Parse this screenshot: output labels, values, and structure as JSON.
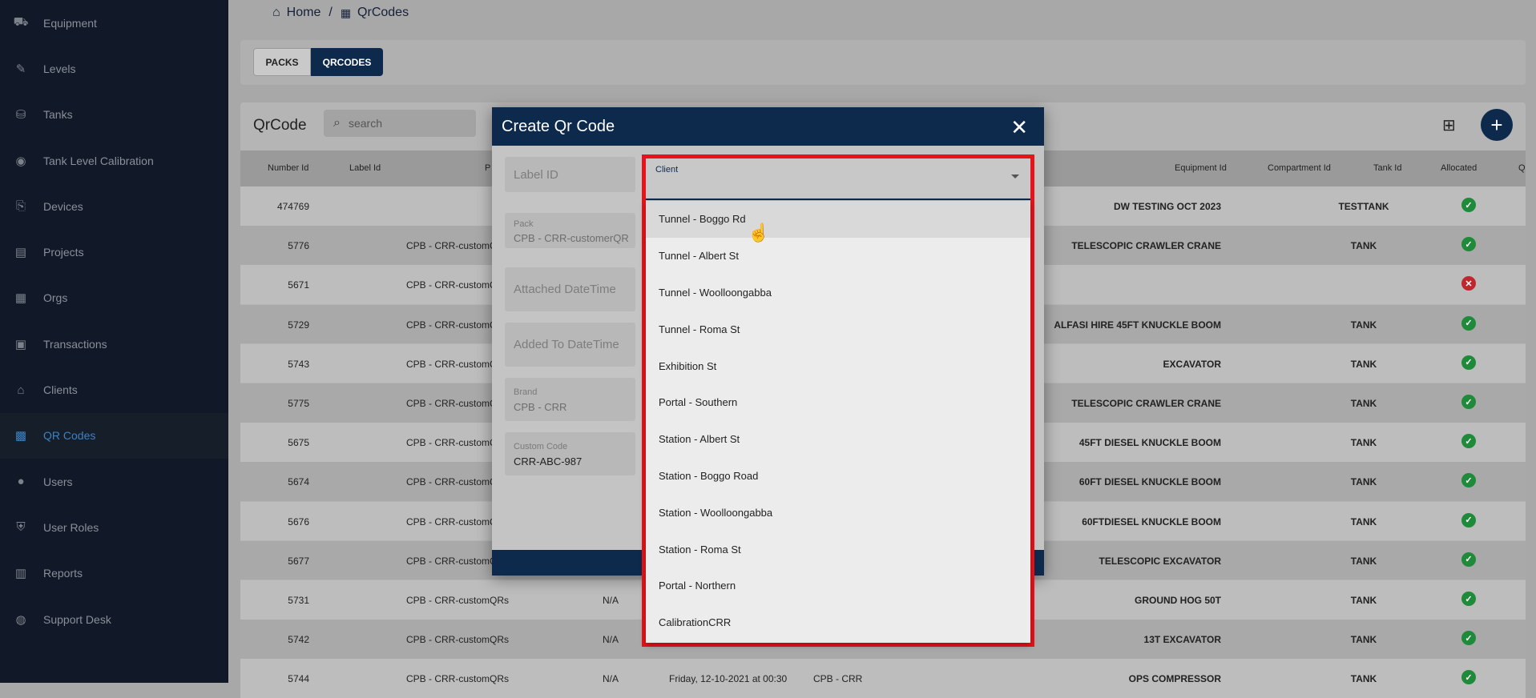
{
  "sidebar": {
    "items": [
      {
        "label": "Equipment",
        "icon": "truck-icon"
      },
      {
        "label": "Levels",
        "icon": "ruler-icon"
      },
      {
        "label": "Tanks",
        "icon": "tank-icon"
      },
      {
        "label": "Tank Level Calibration",
        "icon": "calibration-icon"
      },
      {
        "label": "Devices",
        "icon": "device-icon"
      },
      {
        "label": "Projects",
        "icon": "map-icon"
      },
      {
        "label": "Orgs",
        "icon": "building-icon"
      },
      {
        "label": "Transactions",
        "icon": "receipt-icon"
      },
      {
        "label": "Clients",
        "icon": "bank-icon"
      },
      {
        "label": "QR Codes",
        "icon": "qr-icon"
      },
      {
        "label": "Users",
        "icon": "user-icon"
      },
      {
        "label": "User Roles",
        "icon": "shield-icon"
      },
      {
        "label": "Reports",
        "icon": "chart-icon"
      },
      {
        "label": "Support Desk",
        "icon": "support-icon"
      }
    ],
    "active_index": 9
  },
  "breadcrumb": {
    "home": "Home",
    "separator": "/",
    "current": "QrCodes"
  },
  "tabs": {
    "packs": "PACKS",
    "qrcodes": "QRCODES"
  },
  "table": {
    "title": "QrCode",
    "search_placeholder": "search",
    "columns": {
      "number_id": "Number Id",
      "label_id": "Label Id",
      "pack": "P",
      "equipment_id": "Equipment Id",
      "compartment_id": "Compartment Id",
      "tank_id": "Tank Id",
      "allocated": "Allocated",
      "extra": "Q"
    },
    "rows": [
      {
        "number": "474769",
        "pack": "",
        "status": "",
        "date": "",
        "brand": "",
        "equipment": "DW TESTING OCT 2023",
        "compartment": "TESTTANK",
        "allocated": true
      },
      {
        "number": "5776",
        "pack": "CPB - CRR-customQ",
        "status": "",
        "date": "",
        "brand": "",
        "equipment": "TELESCOPIC CRAWLER CRANE",
        "compartment": "TANK",
        "allocated": true
      },
      {
        "number": "5671",
        "pack": "CPB - CRR-customQ",
        "status": "",
        "date": "",
        "brand": "",
        "equipment": "",
        "compartment": "",
        "allocated": false
      },
      {
        "number": "5729",
        "pack": "CPB - CRR-customQ",
        "status": "",
        "date": "",
        "brand": "",
        "equipment": "ALFASI HIRE 45FT KNUCKLE BOOM",
        "compartment": "TANK",
        "allocated": true
      },
      {
        "number": "5743",
        "pack": "CPB - CRR-customQ",
        "status": "",
        "date": "",
        "brand": "",
        "equipment": "EXCAVATOR",
        "compartment": "TANK",
        "allocated": true
      },
      {
        "number": "5775",
        "pack": "CPB - CRR-customQ",
        "status": "",
        "date": "",
        "brand": "",
        "equipment": "TELESCOPIC CRAWLER CRANE",
        "compartment": "TANK",
        "allocated": true
      },
      {
        "number": "5675",
        "pack": "CPB - CRR-customQ",
        "status": "",
        "date": "",
        "brand": "",
        "equipment": "45FT DIESEL KNUCKLE BOOM",
        "compartment": "TANK",
        "allocated": true
      },
      {
        "number": "5674",
        "pack": "CPB - CRR-customQ",
        "status": "",
        "date": "",
        "brand": "",
        "equipment": "60FT DIESEL KNUCKLE BOOM",
        "compartment": "TANK",
        "allocated": true
      },
      {
        "number": "5676",
        "pack": "CPB - CRR-customQ",
        "status": "",
        "date": "",
        "brand": "",
        "equipment": "60FTDIESEL KNUCKLE BOOM",
        "compartment": "TANK",
        "allocated": true
      },
      {
        "number": "5677",
        "pack": "CPB - CRR-customQ",
        "status": "",
        "date": "",
        "brand": "",
        "equipment": "TELESCOPIC EXCAVATOR",
        "compartment": "TANK",
        "allocated": true
      },
      {
        "number": "5731",
        "pack": "CPB - CRR-customQRs",
        "status": "N/A",
        "date": "",
        "brand": "",
        "equipment": "GROUND HOG 50T",
        "compartment": "TANK",
        "allocated": true
      },
      {
        "number": "5742",
        "pack": "CPB - CRR-customQRs",
        "status": "N/A",
        "date": "",
        "brand": "",
        "equipment": "13T EXCAVATOR",
        "compartment": "TANK",
        "allocated": true
      },
      {
        "number": "5744",
        "pack": "CPB - CRR-customQRs",
        "status": "N/A",
        "date": "Friday, 12-10-2021 at 00:30",
        "brand": "CPB - CRR",
        "equipment": "OPS COMPRESSOR",
        "compartment": "TANK",
        "allocated": true
      }
    ]
  },
  "modal": {
    "title": "Create Qr Code",
    "label_id_placeholder": "Label ID",
    "pack": {
      "label": "Pack",
      "value": "CPB - CRR-customerQR"
    },
    "attached_placeholder": "Attached DateTime",
    "added_placeholder": "Added To DateTime",
    "brand": {
      "label": "Brand",
      "value": "CPB - CRR"
    },
    "custom_code": {
      "label": "Custom Code",
      "value": "CRR-ABC-987"
    },
    "client_label": "Client",
    "client_options": [
      "Tunnel - Boggo Rd",
      "Tunnel - Albert St",
      "Tunnel - Woolloongabba",
      "Tunnel - Roma St",
      "Exhibition St",
      "Portal - Southern",
      "Station - Albert St",
      "Station - Boggo Road",
      "Station - Woolloongabba",
      "Station - Roma St",
      "Portal - Northern",
      "CalibrationCRR"
    ]
  },
  "colors": {
    "navy": "#0d2a4d",
    "highlight_frame": "#e8131a",
    "allocated_yes": "#1f8a3a",
    "allocated_no": "#c0262d"
  }
}
